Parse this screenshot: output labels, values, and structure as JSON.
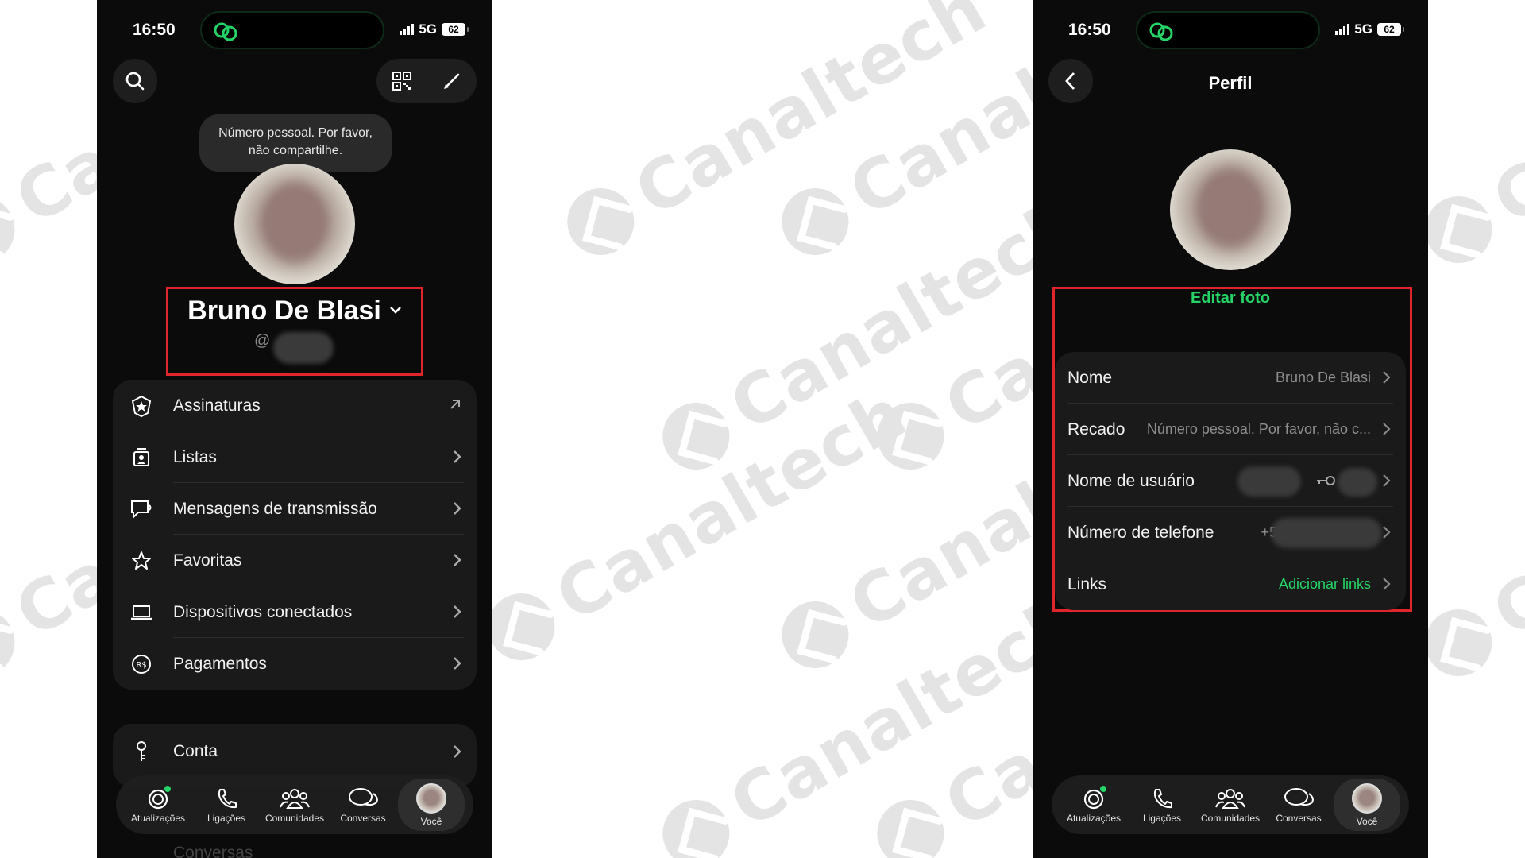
{
  "watermark": {
    "text": "Canaltech"
  },
  "left_screen": {
    "status": {
      "time": "16:50",
      "network": "5G",
      "battery": "62"
    },
    "tooltip": "Número pessoal. Por favor, não compartilhe.",
    "profile": {
      "name": "Bruno De Blasi",
      "handle_prefix": "@"
    },
    "menu": [
      {
        "label": "Assinaturas",
        "icon": "subscriptions-badge-icon"
      },
      {
        "label": "Listas",
        "icon": "lists-icon"
      },
      {
        "label": "Mensagens de transmissão",
        "icon": "broadcast-icon"
      },
      {
        "label": "Favoritas",
        "icon": "star-icon"
      },
      {
        "label": "Dispositivos conectados",
        "icon": "laptop-icon"
      },
      {
        "label": "Pagamentos",
        "icon": "payments-icon"
      }
    ],
    "account": {
      "label": "Conta",
      "icon": "key-icon"
    },
    "under_tabbar_label": "Conversas"
  },
  "right_screen": {
    "status": {
      "time": "16:50",
      "network": "5G",
      "battery": "62"
    },
    "title": "Perfil",
    "edit_photo": "Editar foto",
    "fields": [
      {
        "label": "Nome",
        "value": "Bruno De Blasi"
      },
      {
        "label": "Recado",
        "value": "Número pessoal. Por favor, não c..."
      },
      {
        "label": "Nome de usuário",
        "value": ""
      },
      {
        "label": "Número de telefone",
        "value": "+55"
      },
      {
        "label": "Links",
        "value": "Adicionar links"
      }
    ]
  },
  "tabbar": [
    {
      "label": "Atualizações",
      "icon": "updates-icon"
    },
    {
      "label": "Ligações",
      "icon": "phone-icon"
    },
    {
      "label": "Comunidades",
      "icon": "communities-icon"
    },
    {
      "label": "Conversas",
      "icon": "chats-icon"
    },
    {
      "label": "Você",
      "icon": "avatar"
    }
  ],
  "colors": {
    "accent": "#25d366",
    "highlight_box": "#e0262c",
    "background": "#0b0b0b"
  }
}
